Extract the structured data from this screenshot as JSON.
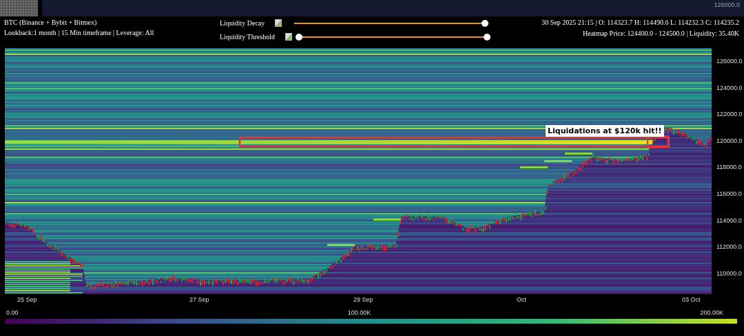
{
  "navigator": {
    "label": "126000.0"
  },
  "header": {
    "title": "BTC (Binance + Bybit + Bitmex)",
    "subtitle": "Lookback:1 month | 15 Min timeframe | Leverage: All"
  },
  "sliders": [
    {
      "label": "Liquidity Decay",
      "thumbs": [
        {
          "level": 1
        }
      ]
    },
    {
      "label": "Liquidity Threshold",
      "thumbs": [
        {
          "level": 0
        },
        {
          "level": 1
        }
      ]
    }
  ],
  "info": {
    "ohlc": "30 Sep 2025 21:15 | O: 114323.7 H: 114490.6 L: 114232.3 C: 114235.2",
    "heatmap": "Heatmap Price: 124400.0 - 124500.0 | Liquidity: 35.40K"
  },
  "chart": {
    "annotation": "Liquidations at $120k hit!!",
    "y_labels": [
      "126000.0",
      "124000.0",
      "122000.0",
      "120000.0",
      "118000.0",
      "116000.0",
      "114000.0",
      "112000.0",
      "110000.0"
    ],
    "x_labels": [
      "25 Sep",
      "27 Sep",
      "29 Sep",
      "Oct",
      "03 Oct"
    ]
  },
  "colorbar": {
    "labels": [
      "0.00",
      "100.00K",
      "200.00K"
    ]
  }
}
